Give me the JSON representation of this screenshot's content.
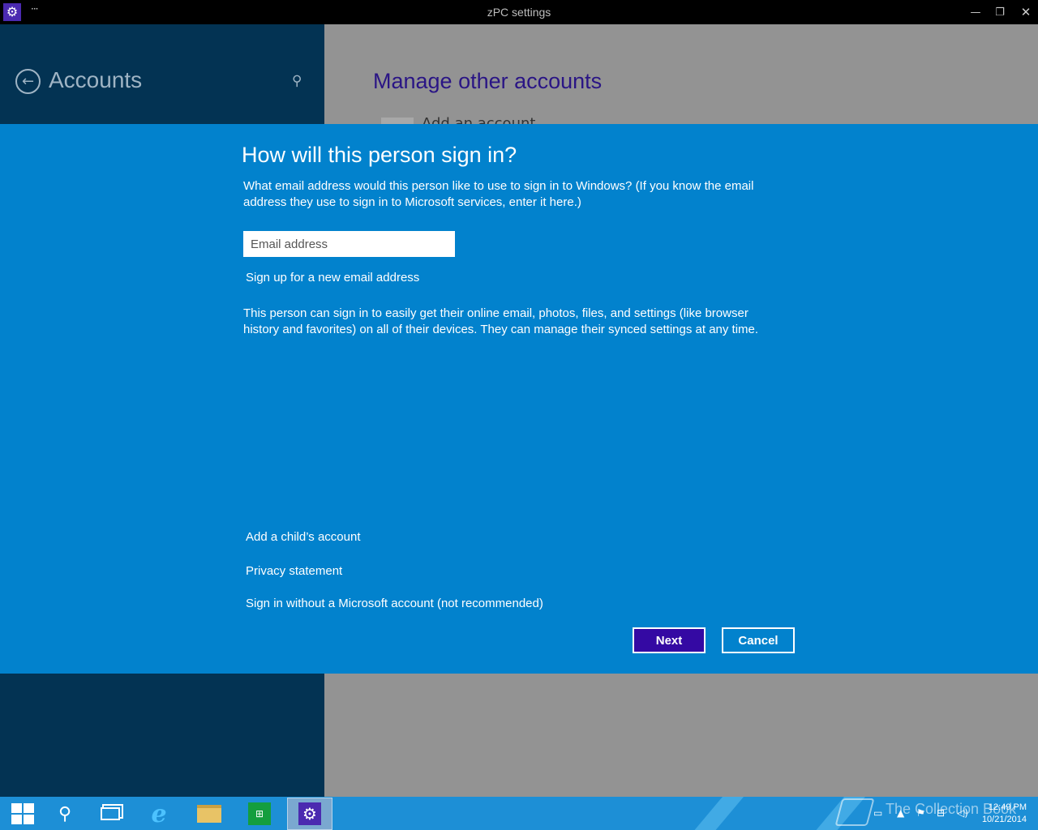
{
  "window": {
    "title": "zPC settings",
    "more_glyph": "···",
    "app_icon": "gear-icon",
    "minimize_glyph": "—",
    "restore_glyph": "❐",
    "close_glyph": "✕"
  },
  "left_pane": {
    "header": "Accounts",
    "back_glyph": "←",
    "search_glyph": "⚲"
  },
  "right_pane": {
    "header": "Manage other accounts",
    "row_text": "Add an account"
  },
  "dialog": {
    "title": "How will this person sign in?",
    "description": "What email address would this person like to use to sign in to Windows? (If you know the email address they use to sign in to Microsoft services, enter it here.)",
    "email_placeholder": "Email address",
    "email_value": "",
    "signup_link": "Sign up for a new email address",
    "info": "This person can sign in to easily get their online email, photos, files, and settings (like browser history and favorites) on all of their devices. They can manage their synced settings at any time.",
    "child_link": "Add a child’s account",
    "privacy_link": "Privacy statement",
    "no_msa_link": "Sign in without a Microsoft account (not recommended)",
    "next_label": "Next",
    "cancel_label": "Cancel"
  },
  "taskbar": {
    "apps": [
      "start",
      "search",
      "task-view",
      "internet-explorer",
      "file-explorer",
      "store",
      "settings"
    ],
    "search_glyph": "⚲",
    "ie_glyph": "e",
    "store_glyph": "⊞",
    "settings_glyph": "⚙",
    "tray_icons": [
      "keyboard-icon",
      "up-arrow-icon",
      "flag-icon",
      "network-icon",
      "volume-icon"
    ],
    "watermark": "The Collection Book",
    "time": "12:49 PM",
    "date": "10/21/2014"
  },
  "colors": {
    "dialog_bg": "#0282cd",
    "left_pane_bg": "#033353",
    "right_pane_bg": "#939393",
    "next_button_bg": "#3409a3",
    "taskbar_bg": "#1d8fd6",
    "accent_header": "#2a1585"
  }
}
